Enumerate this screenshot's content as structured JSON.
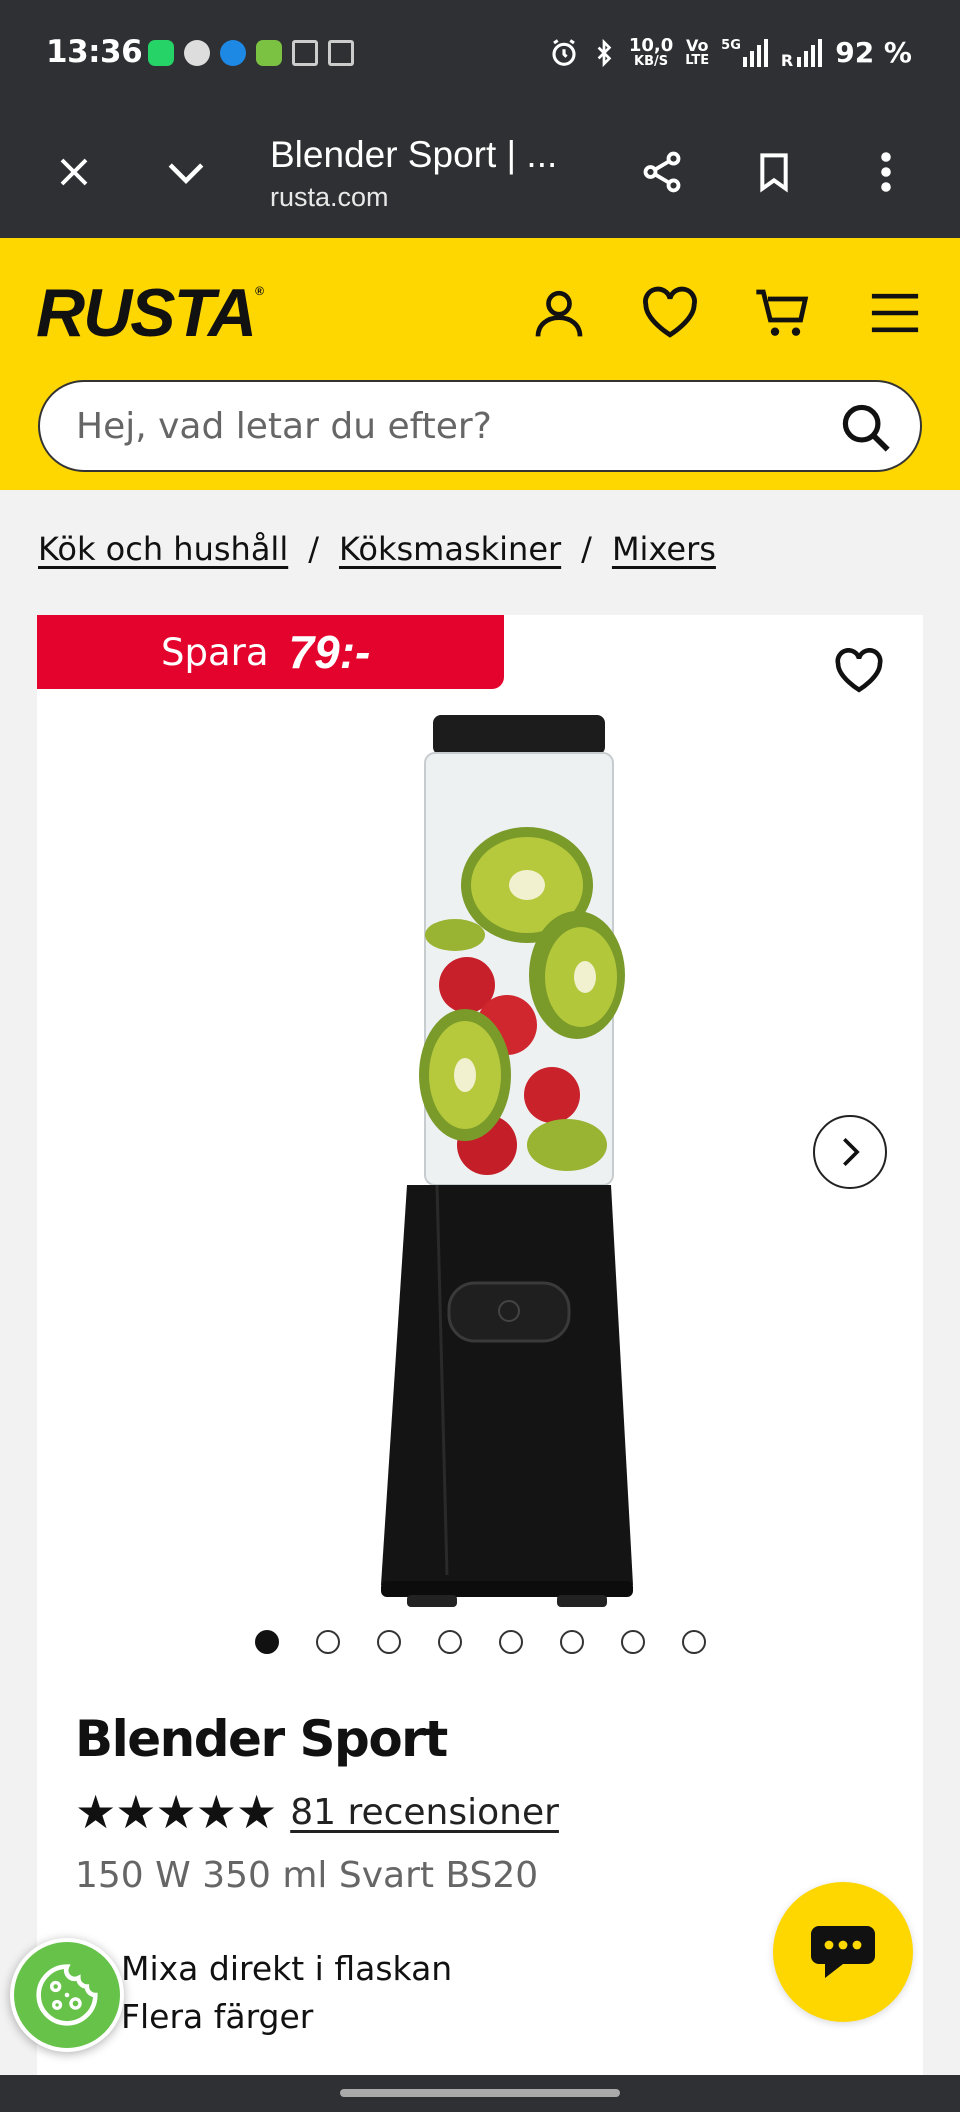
{
  "status_bar": {
    "time": "13:36",
    "net_speed_value": "10,0",
    "net_speed_unit": "KB/S",
    "volte_top": "Vo",
    "volte_bottom": "LTE",
    "net_type": "5G",
    "roaming": "R",
    "battery": "92 %",
    "notification_icons": [
      "whatsapp-icon",
      "messages-icon",
      "cloud-icon",
      "app-icon",
      "gmail-icon",
      "gmail-icon"
    ]
  },
  "browser": {
    "page_title": "Blender Sport | ...",
    "url": "rusta.com"
  },
  "header": {
    "logo": "RUSTA",
    "logo_mark": "®",
    "search_placeholder": "Hej, vad letar du efter?"
  },
  "breadcrumb": {
    "items": [
      "Kök och hushåll",
      "Köksmaskiner",
      "Mixers"
    ],
    "separator": "/"
  },
  "product": {
    "save_label": "Spara",
    "save_amount": "79:-",
    "name": "Blender Sport",
    "rating_stars": 4.5,
    "stars_display": "★★★★★",
    "reviews": "81 recensioner",
    "subtitle": "150 W 350 ml Svart BS20",
    "features": [
      "Mixa direkt i flaskan",
      "Flera färger"
    ],
    "image_count": 8,
    "active_image": 1
  },
  "colors": {
    "brand_yellow": "#fed600",
    "sale_red": "#e4032c",
    "dark_bar": "#2f3033",
    "cookie_green": "#67c24a"
  }
}
